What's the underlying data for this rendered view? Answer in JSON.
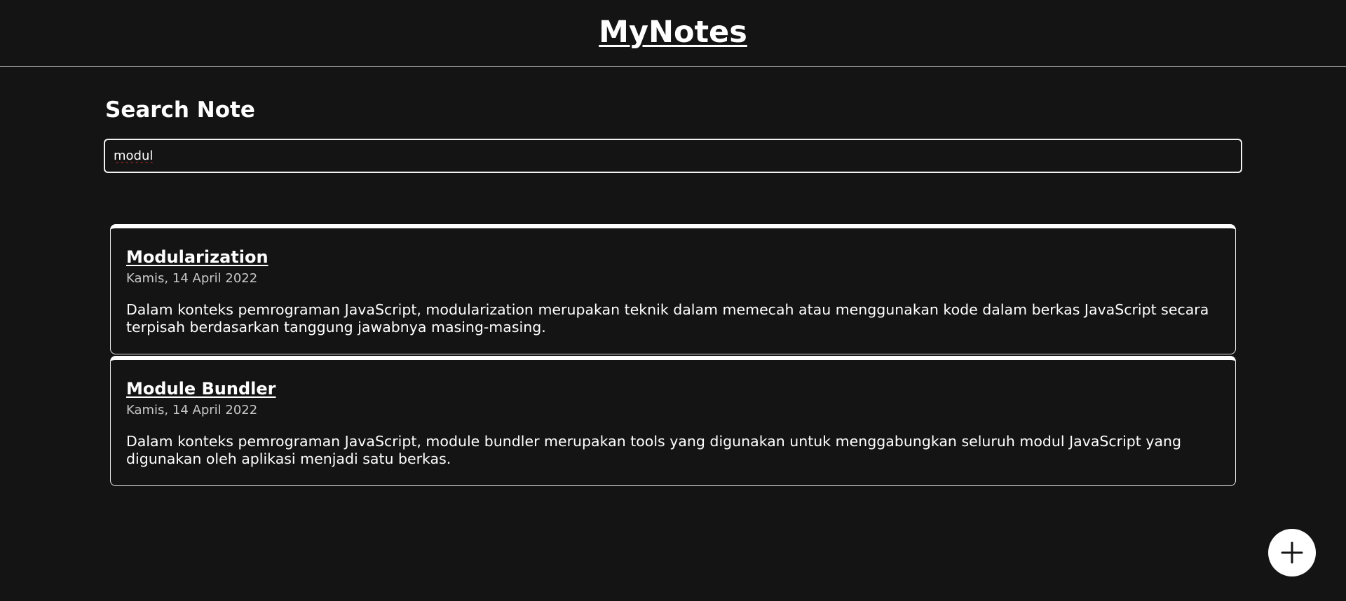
{
  "header": {
    "title": "MyNotes"
  },
  "search": {
    "heading": "Search Note",
    "value": "modul",
    "placeholder": ""
  },
  "notes": [
    {
      "title": "Modularization",
      "date": "Kamis, 14 April 2022",
      "body": "Dalam konteks pemrograman JavaScript, modularization merupakan teknik dalam memecah atau menggunakan kode dalam berkas JavaScript secara terpisah berdasarkan tanggung jawabnya masing-masing."
    },
    {
      "title": "Module Bundler",
      "date": "Kamis, 14 April 2022",
      "body": "Dalam konteks pemrograman JavaScript, module bundler merupakan tools yang digunakan untuk menggabungkan seluruh modul JavaScript yang digunakan oleh aplikasi menjadi satu berkas."
    }
  ],
  "add_button": {
    "icon": "plus-icon"
  },
  "colors": {
    "background": "#141414",
    "text": "#ffffff",
    "muted_text": "#c8c8c8",
    "border": "#e6e6e6",
    "spellcheck_underline": "#d42a2a"
  }
}
